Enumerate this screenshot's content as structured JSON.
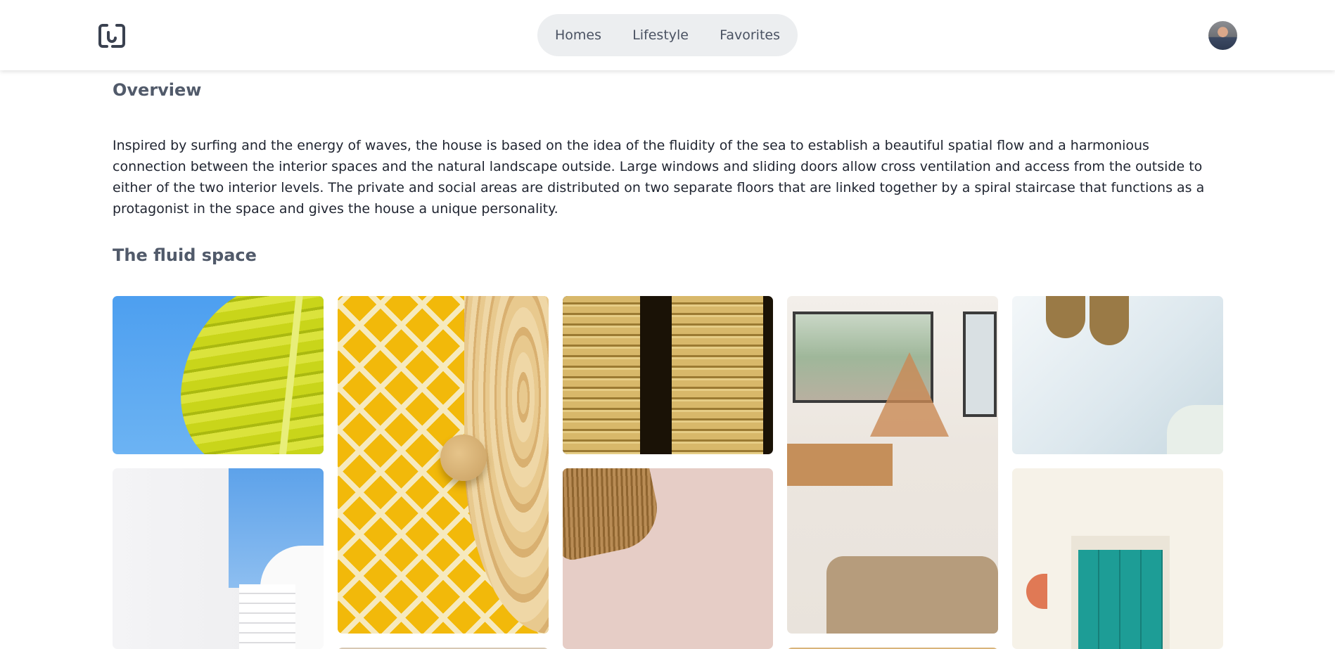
{
  "header": {
    "nav": [
      {
        "label": "Homes"
      },
      {
        "label": "Lifestyle"
      },
      {
        "label": "Favorites"
      }
    ]
  },
  "overview": {
    "title": "Overview",
    "text": "Inspired by surfing and the energy of waves, the house is based on the idea of the fluidity of the sea to establish a beautiful spatial flow and a harmonious connection between the interior spaces and the natural landscape outside. Large windows and sliding doors allow cross ventilation and access from the outside to either of the two interior levels. The private and social areas are distributed on two separate floors that are linked together by a spiral staircase that functions as a protagonist in the space and gives the house a unique personality."
  },
  "gallery": {
    "title": "The fluid space",
    "items": [
      {
        "icon": "banana-leaf-photo"
      },
      {
        "icon": "yellow-rug-wood-photo"
      },
      {
        "icon": "wooden-shutters-photo"
      },
      {
        "icon": "dining-room-photo"
      },
      {
        "icon": "pendant-lamps-photo"
      },
      {
        "icon": "white-stairs-photo"
      },
      {
        "icon": "wicker-lamp-photo"
      },
      {
        "icon": "teal-door-photo"
      }
    ]
  },
  "colors": {
    "nav_bg": "#eceef0",
    "heading": "#515a6a",
    "text": "#1f2430"
  }
}
